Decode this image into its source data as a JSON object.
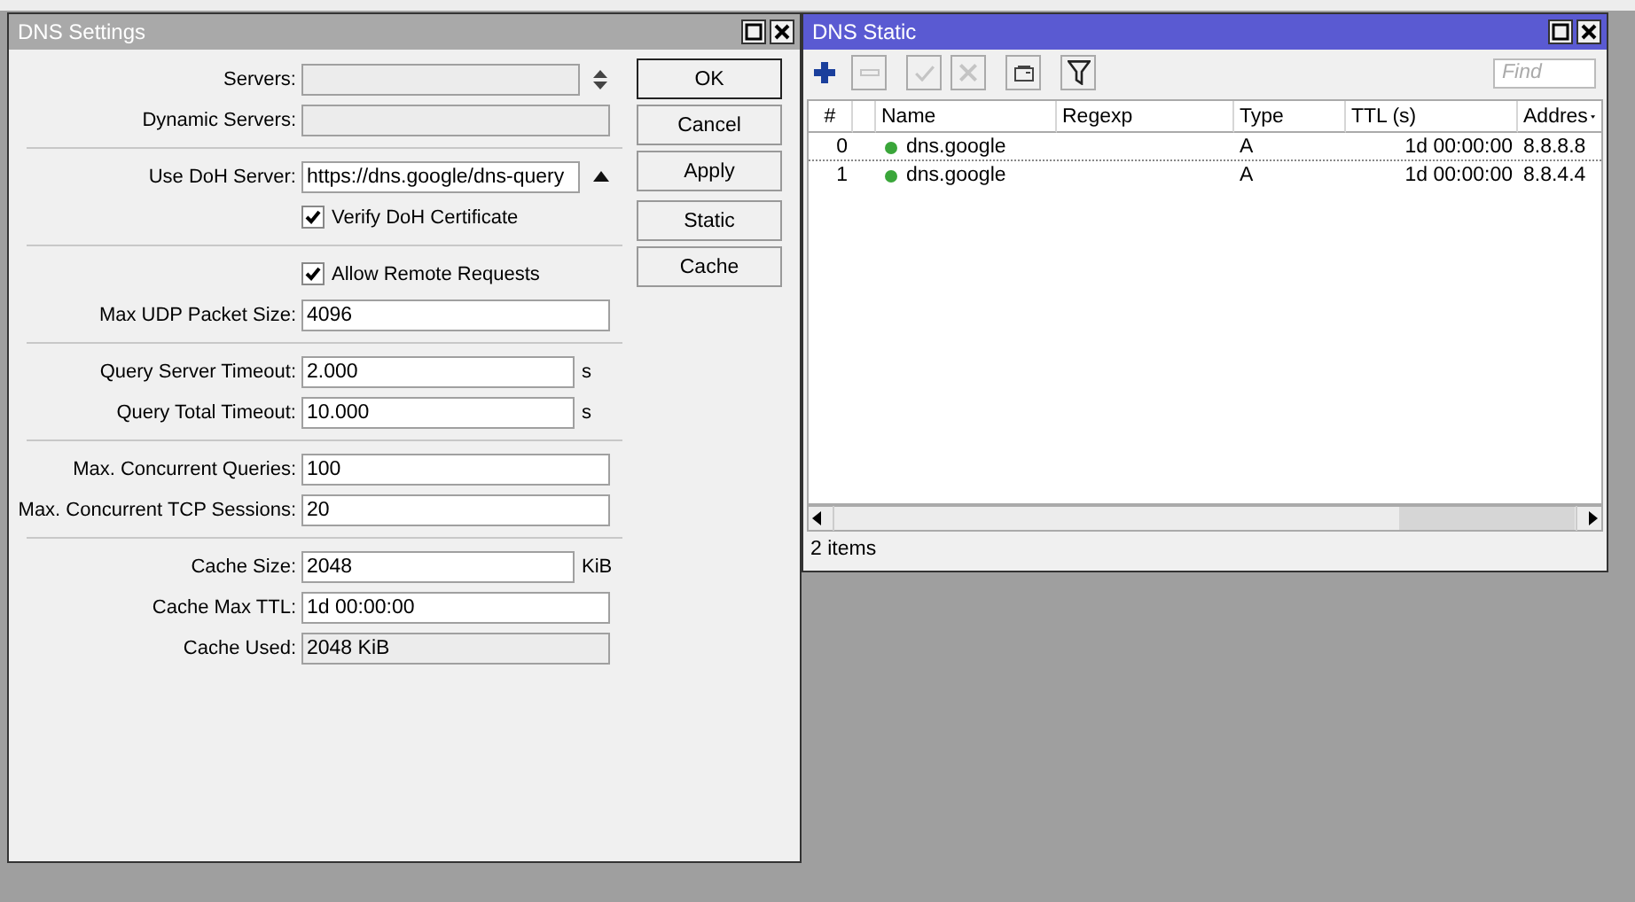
{
  "settings_window": {
    "title": "DNS Settings",
    "active": false,
    "rows": [
      {
        "kind": "field",
        "label": "Servers:",
        "disabled": true,
        "spinner": true
      },
      {
        "kind": "field",
        "label": "Dynamic Servers:",
        "disabled": true
      },
      {
        "kind": "separator"
      },
      {
        "kind": "field",
        "label": "Use DoH Server:",
        "value": "https://dns.google/dns-query",
        "disabled": false,
        "history": true
      },
      {
        "kind": "checkbox",
        "label": "Verify DoH Certificate",
        "checked": true
      },
      {
        "kind": "separator"
      },
      {
        "kind": "checkbox",
        "label": "Allow Remote Requests",
        "checked": true
      },
      {
        "kind": "field",
        "label": "Max UDP Packet Size:",
        "value": "4096",
        "disabled": false
      },
      {
        "kind": "separator"
      },
      {
        "kind": "field",
        "label": "Query Server Timeout:",
        "value": "2.000",
        "unit": "s",
        "disabled": false
      },
      {
        "kind": "field",
        "label": "Query Total Timeout:",
        "value": "10.000",
        "unit": "s",
        "disabled": false
      },
      {
        "kind": "separator"
      },
      {
        "kind": "field",
        "label": "Max. Concurrent Queries:",
        "value": "100",
        "disabled": false
      },
      {
        "kind": "field",
        "label": "Max. Concurrent TCP Sessions:",
        "value": "20",
        "disabled": false
      },
      {
        "kind": "separator"
      },
      {
        "kind": "field",
        "label": "Cache Size:",
        "value": "2048",
        "unit": "KiB",
        "disabled": false
      },
      {
        "kind": "field",
        "label": "Cache Max TTL:",
        "value": "1d 00:00:00",
        "disabled": false
      },
      {
        "kind": "field",
        "label": "Cache Used:",
        "value": "2048 KiB",
        "disabled": true
      }
    ],
    "button_groups": [
      [
        {
          "label": "OK",
          "default": true
        },
        {
          "label": "Cancel",
          "default": false
        },
        {
          "label": "Apply",
          "default": false
        }
      ],
      [
        {
          "label": "Static",
          "default": false
        },
        {
          "label": "Cache",
          "default": false
        }
      ]
    ]
  },
  "static_window": {
    "title": "DNS Static",
    "active": true,
    "tools": [
      {
        "kind": "add",
        "disabled": false
      },
      {
        "kind": "remove",
        "disabled": true
      },
      {
        "kind": "enable",
        "disabled": true
      },
      {
        "kind": "disable",
        "disabled": true
      },
      {
        "kind": "comment",
        "disabled": false
      },
      {
        "kind": "filter",
        "disabled": false
      }
    ],
    "find": {
      "placeholder": "Find"
    },
    "columns": [
      "#",
      "Name",
      "Regexp",
      "Type",
      "TTL (s)",
      "Addres"
    ],
    "rows": [
      {
        "number": "0",
        "name": "dns.google",
        "color": "#3aa63a",
        "type": "A",
        "ttl": "1d 00:00:00",
        "address": "8.8.8.8"
      },
      {
        "number": "1",
        "name": "dns.google",
        "color": "#3aa63a",
        "type": "A",
        "ttl": "1d 00:00:00",
        "address": "8.8.4.4"
      }
    ],
    "status": "2 items"
  }
}
